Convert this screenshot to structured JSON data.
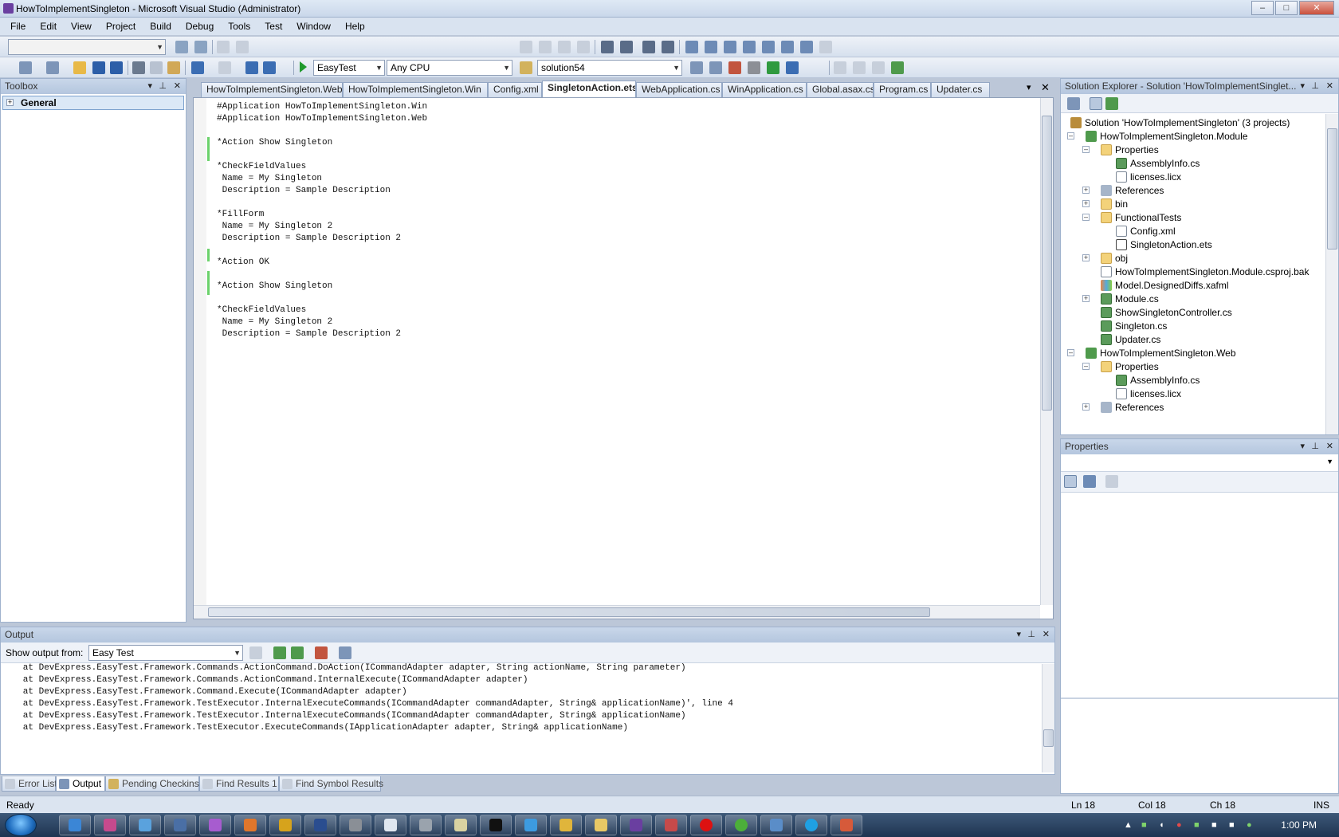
{
  "window": {
    "title": "HowToImplementSingleton - Microsoft Visual Studio (Administrator)",
    "buttons": {
      "minimize": "–",
      "maximize": "□",
      "close": "✕"
    }
  },
  "menu": [
    "File",
    "Edit",
    "View",
    "Project",
    "Build",
    "Debug",
    "Tools",
    "Test",
    "Window",
    "Help"
  ],
  "toolbar": {
    "config": "EasyTest",
    "platform": "Any CPU",
    "find": "solution54"
  },
  "toolbox": {
    "title": "Toolbox",
    "group": "General"
  },
  "editor": {
    "tabs": [
      {
        "label": "HowToImplementSingleton.Web",
        "active": false
      },
      {
        "label": "HowToImplementSingleton.Win",
        "active": false
      },
      {
        "label": "Config.xml",
        "active": false
      },
      {
        "label": "SingletonAction.ets",
        "active": true
      },
      {
        "label": "WebApplication.cs",
        "active": false
      },
      {
        "label": "WinApplication.cs",
        "active": false
      },
      {
        "label": "Global.asax.cs",
        "active": false
      },
      {
        "label": "Program.cs",
        "active": false
      },
      {
        "label": "Updater.cs",
        "active": false
      }
    ],
    "lines": [
      "#Application HowToImplementSingleton.Win",
      "#Application HowToImplementSingleton.Web",
      "",
      "*Action Show Singleton",
      "",
      "*CheckFieldValues",
      " Name = My Singleton",
      " Description = Sample Description",
      "",
      "*FillForm",
      " Name = My Singleton 2",
      " Description = Sample Description 2",
      "",
      "*Action OK",
      "",
      "*Action Show Singleton",
      "",
      "*CheckFieldValues",
      " Name = My Singleton 2",
      " Description = Sample Description 2"
    ]
  },
  "solution_explorer": {
    "title": "Solution Explorer - Solution 'HowToImplementSinglet...",
    "items": [
      {
        "label": "Solution 'HowToImplementSingleton' (3 projects)",
        "icon": "solution-icon"
      },
      {
        "label": "HowToImplementSingleton.Module",
        "icon": "project-icon"
      },
      {
        "label": "Properties",
        "icon": "folder-icon"
      },
      {
        "label": "AssemblyInfo.cs",
        "icon": "cs-file-icon"
      },
      {
        "label": "licenses.licx",
        "icon": "file-icon"
      },
      {
        "label": "References",
        "icon": "references-icon"
      },
      {
        "label": "bin",
        "icon": "folder-icon"
      },
      {
        "label": "FunctionalTests",
        "icon": "folder-icon"
      },
      {
        "label": "Config.xml",
        "icon": "file-icon"
      },
      {
        "label": "SingletonAction.ets",
        "icon": "ets-file-icon"
      },
      {
        "label": "obj",
        "icon": "folder-icon"
      },
      {
        "label": "HowToImplementSingleton.Module.csproj.bak",
        "icon": "file-icon"
      },
      {
        "label": "Model.DesignedDiffs.xafml",
        "icon": "model-icon"
      },
      {
        "label": "Module.cs",
        "icon": "cs-file-icon"
      },
      {
        "label": "ShowSingletonController.cs",
        "icon": "cs-file-icon"
      },
      {
        "label": "Singleton.cs",
        "icon": "cs-file-icon"
      },
      {
        "label": "Updater.cs",
        "icon": "cs-file-icon"
      },
      {
        "label": "HowToImplementSingleton.Web",
        "icon": "project-icon"
      },
      {
        "label": "Properties",
        "icon": "folder-icon"
      },
      {
        "label": "AssemblyInfo.cs",
        "icon": "cs-file-icon"
      },
      {
        "label": "licenses.licx",
        "icon": "file-icon"
      },
      {
        "label": "References",
        "icon": "references-icon"
      }
    ]
  },
  "properties": {
    "title": "Properties"
  },
  "output": {
    "title": "Output",
    "show_label": "Show output from:",
    "source": "Easy Test",
    "lines": [
      "   at DevExpress.EasyTest.Framework.Commands.ActionCommand.DoAction(ICommandAdapter adapter, String actionName, String parameter)",
      "   at DevExpress.EasyTest.Framework.Commands.ActionCommand.InternalExecute(ICommandAdapter adapter)",
      "   at DevExpress.EasyTest.Framework.Command.Execute(ICommandAdapter adapter)",
      "   at DevExpress.EasyTest.Framework.TestExecutor.InternalExecuteCommands(ICommandAdapter commandAdapter, String& applicationName)', line 4",
      "   at DevExpress.EasyTest.Framework.TestExecutor.InternalExecuteCommands(ICommandAdapter commandAdapter, String& applicationName)",
      "   at DevExpress.EasyTest.Framework.TestExecutor.ExecuteCommands(IApplicationAdapter adapter, String& applicationName)"
    ]
  },
  "bottom_tabs": [
    {
      "label": "Error List",
      "active": false
    },
    {
      "label": "Output",
      "active": true
    },
    {
      "label": "Pending Checkins",
      "active": false
    },
    {
      "label": "Find Results 1",
      "active": false
    },
    {
      "label": "Find Symbol Results",
      "active": false
    }
  ],
  "status": {
    "ready": "Ready",
    "ln": "Ln 18",
    "col": "Col 18",
    "ch": "Ch 18",
    "mode": "INS"
  },
  "taskbar": {
    "clock": "1:00 PM"
  }
}
